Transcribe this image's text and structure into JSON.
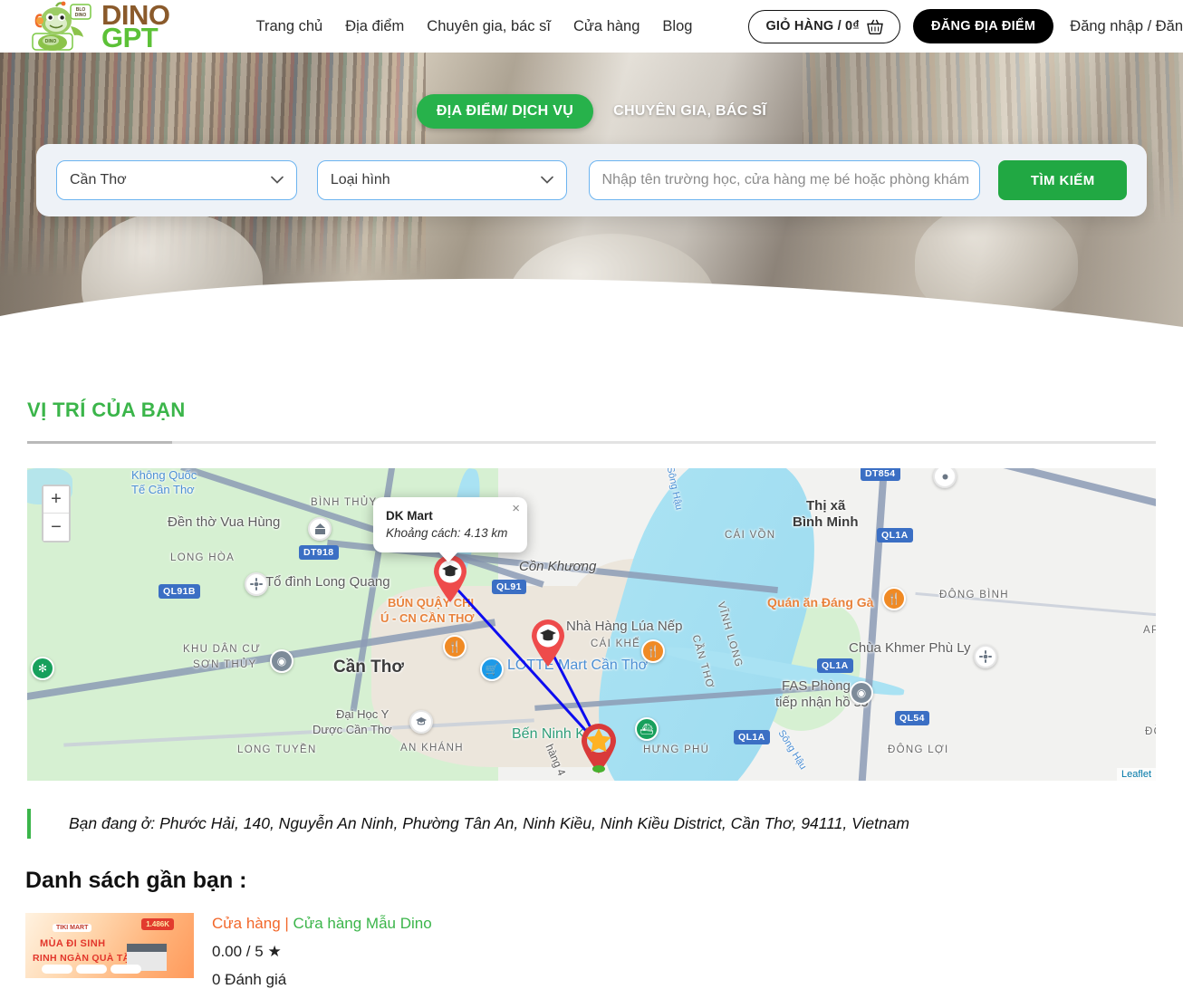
{
  "header": {
    "logo": {
      "line1": "DINO",
      "line2": "GPT",
      "mascot_icon": "dino-mascot-icon"
    },
    "nav": [
      {
        "label": "Trang chủ",
        "name": "nav-home"
      },
      {
        "label": "Địa điểm",
        "name": "nav-places"
      },
      {
        "label": "Chuyên gia, bác sĩ",
        "name": "nav-experts"
      },
      {
        "label": "Cửa hàng",
        "name": "nav-shop"
      },
      {
        "label": "Blog",
        "name": "nav-blog"
      }
    ],
    "cart_label": "GIỎ HÀNG / 0₫",
    "cart_icon": "basket-icon",
    "post_place_label": "ĐĂNG ĐỊA ĐIỂM",
    "auth_label": "Đăng nhập / Đăng ký"
  },
  "hero": {
    "tabs": [
      {
        "label": "ĐỊA ĐIỂM/ DỊCH VỤ",
        "active": true
      },
      {
        "label": "CHUYÊN GIA, BÁC SĨ",
        "active": false
      }
    ],
    "province_select": "Cần Thơ",
    "type_select": "Loại hình",
    "keyword_placeholder": "Nhập tên trường học, cửa hàng mẹ bé hoặc phòng khám",
    "search_button": "TÌM KIẾM",
    "accent_green": "#27b24b"
  },
  "section": {
    "title": "VỊ TRÍ CỦA BẠN"
  },
  "map": {
    "zoom_in": "+",
    "zoom_out": "−",
    "attribution": "Leaflet",
    "popup": {
      "title": "DK Mart",
      "distance": "Khoảng cách: 4.13 km",
      "close": "×"
    },
    "labels": [
      "Không Quốc",
      "Tế Cần Thơ",
      "Đền thờ Vua Hùng",
      "BÌNH THỦY",
      "LONG HÒA",
      "Tổ đình Long Quang",
      "KHU DÂN CƯ",
      "SƠN THỦY",
      "Cần Thơ",
      "Đại Học Y",
      "Dược Cần Thơ",
      "LONG TUYỀN",
      "AN KHÁNH",
      "BÚN QUẬY CHỊ",
      "Ú - CN CẦN THƠ",
      "Cồn Khương",
      "LOTTE Mart Cần Thơ",
      "Bến Ninh Kiều",
      "Nhà Hàng Lúa Nếp",
      "CÁI KHẾ",
      "VĨNH LONG",
      "CẦN THƠ",
      "HƯNG PHÚ",
      "Sông Hậu",
      "CÁI VỒN",
      "Thị xã",
      "Bình Minh",
      "Quán ăn Đáng Gà",
      "ĐÔNG BÌNH",
      "Chùa Khmer Phù Ly",
      "FAS Phòng",
      "tiếp nhận hồ sơ",
      "ĐÔNG LỢI",
      "AP",
      "ĐỒN",
      "Sông Hậu",
      "hàng 4"
    ],
    "road_shields": [
      "DT918",
      "QL91B",
      "QL91",
      "DT854",
      "QL1A",
      "QL1A",
      "QL1A",
      "QL54"
    ]
  },
  "address": {
    "text": "Bạn đang ở: Phước Hải, 140, Nguyễn An Ninh, Phường Tân An, Ninh Kiều, Ninh Kiều District, Cần Thơ, 94111, Vietnam"
  },
  "nearby": {
    "heading": "Danh sách gần bạn :",
    "items": [
      {
        "category": "Cửa hàng",
        "separator": "|",
        "name": "Cửa hàng Mẫu Dino",
        "rating": "0.00 / 5",
        "star_icon": "star-icon",
        "reviews": "0 Đánh giá",
        "thumb": {
          "badge": "1.486K",
          "line1": "MÙA ĐI SINH",
          "line2": "RINH NGÀN QUÀ TẶNG",
          "logo": "TIKI MART"
        }
      }
    ]
  }
}
